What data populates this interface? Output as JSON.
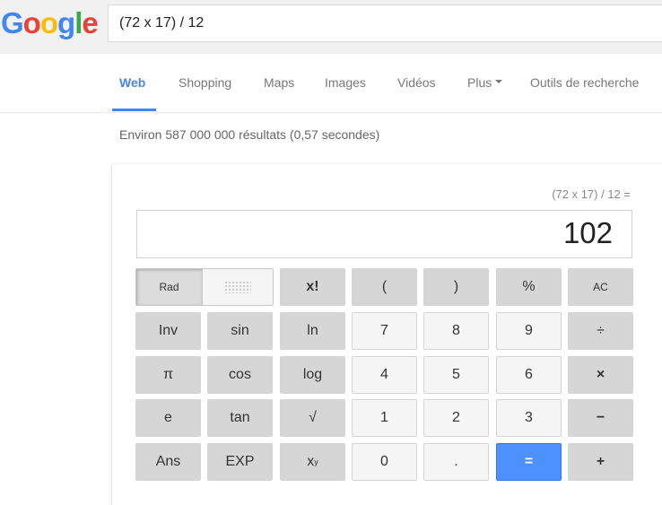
{
  "header": {
    "logo_letters": [
      {
        "char": "G",
        "color": "#4285f4"
      },
      {
        "char": "o",
        "color": "#ea4335"
      },
      {
        "char": "o",
        "color": "#fbbc05"
      },
      {
        "char": "g",
        "color": "#4285f4"
      },
      {
        "char": "l",
        "color": "#34a853"
      },
      {
        "char": "e",
        "color": "#ea4335"
      }
    ],
    "search_value": "(72 x 17) / 12"
  },
  "tabs": {
    "web": "Web",
    "shopping": "Shopping",
    "maps": "Maps",
    "images": "Images",
    "videos": "Vidéos",
    "plus": "Plus",
    "tools": "Outils de recherche"
  },
  "results": {
    "count": "Environ 587 000 000 résultats (0,57 secondes)"
  },
  "calculator": {
    "expression": "(72 x 17) / 12 =",
    "display_value": "102",
    "rad_label": "Rad",
    "keys": {
      "fact": "x!",
      "lparen": "(",
      "rparen": ")",
      "percent": "%",
      "ac": "AC",
      "inv": "Inv",
      "sin": "sin",
      "ln": "ln",
      "d7": "7",
      "d8": "8",
      "d9": "9",
      "divide": "÷",
      "pi": "π",
      "cos": "cos",
      "log": "log",
      "d4": "4",
      "d5": "5",
      "d6": "6",
      "multiply": "×",
      "e": "e",
      "tan": "tan",
      "sqrt": "√",
      "d1": "1",
      "d2": "2",
      "d3": "3",
      "minus": "−",
      "ans": "Ans",
      "exp": "EXP",
      "power_base": "x",
      "power_exp": "y",
      "d0": "0",
      "dot": ".",
      "equals": "=",
      "plus": "+"
    }
  }
}
